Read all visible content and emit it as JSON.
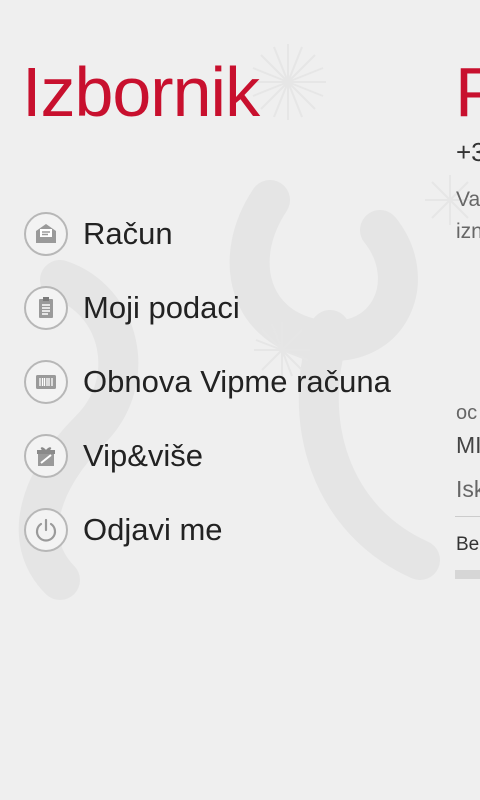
{
  "page": {
    "title": "Izbornik"
  },
  "menu": {
    "items": [
      {
        "label": "Račun",
        "icon": "envelope-icon"
      },
      {
        "label": "Moji podaci",
        "icon": "clipboard-icon"
      },
      {
        "label": "Obnova Vipme računa",
        "icon": "barcode-card-icon"
      },
      {
        "label": "Vip&više",
        "icon": "gift-icon"
      },
      {
        "label": "Odjavi me",
        "icon": "power-icon"
      }
    ]
  },
  "peek": {
    "title": "P",
    "phone": "+3",
    "line1": "Va",
    "line2": "izn",
    "line3": "oc",
    "line4": "MI",
    "line5": "Isk",
    "line6": "Be"
  },
  "colors": {
    "accent": "#c8102e",
    "background": "#efefef"
  }
}
